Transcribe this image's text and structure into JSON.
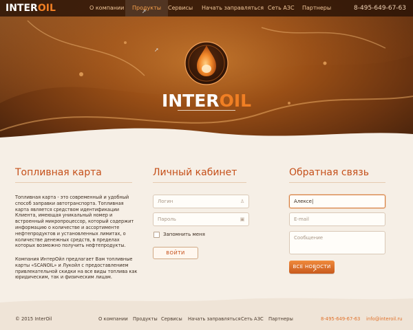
{
  "brand": {
    "part1": "INTER",
    "part2": "OIL"
  },
  "nav": {
    "items": [
      "О компании",
      "Продукты",
      "Сервисы",
      "Начать заправляться",
      "Сеть АЗС",
      "Партнеры"
    ],
    "active_index": 1,
    "phone": "8-495-649-67-63"
  },
  "colors": {
    "accent": "#c5501a",
    "orange": "#f07f24",
    "hero_dark": "#3e1e0b",
    "background": "#f6efe6"
  },
  "fuel_card": {
    "title": "Топливная карта",
    "paragraph1": "Топливная карта - это современный и удобный способ заправки автотранспорта. Топливная карта является средством идентификации Клиента, имеющая уникальный номер и встроенный микропроцессор, который содержит информацию о количестве и ассортименте нефтепродуктов и установленных лимитах, о количестве денежных средств, в пределах которых возможно получить нефтепродукты.",
    "paragraph2": "Компания ИнтерОйл предлагает Вам топливные карты «SCANOIL» и Лукойл с предоставлением привлекательной скидки на все виды топлива как юридическим, так и физическим лицам."
  },
  "cabinet": {
    "title": "Личный кабинет",
    "login_placeholder": "Логин",
    "password_placeholder": "Пароль",
    "remember_label": "Запомнить меня",
    "submit_label": "ВОЙТИ"
  },
  "feedback": {
    "title": "Обратная связь",
    "name_value": "Алексе|",
    "email_placeholder": "E-mail",
    "message_placeholder": "Сообщение",
    "submit_label": "ВСЕ НОВОСТИ"
  },
  "footer": {
    "copyright": "© 2015 InterOil",
    "links": [
      "О компании",
      "Продукты",
      "Сервисы",
      "Начать заправляться",
      "Сеть АЗС",
      "Партнеры"
    ],
    "phone": "8-495-649-67-63",
    "email": "info@interoil.ru"
  }
}
